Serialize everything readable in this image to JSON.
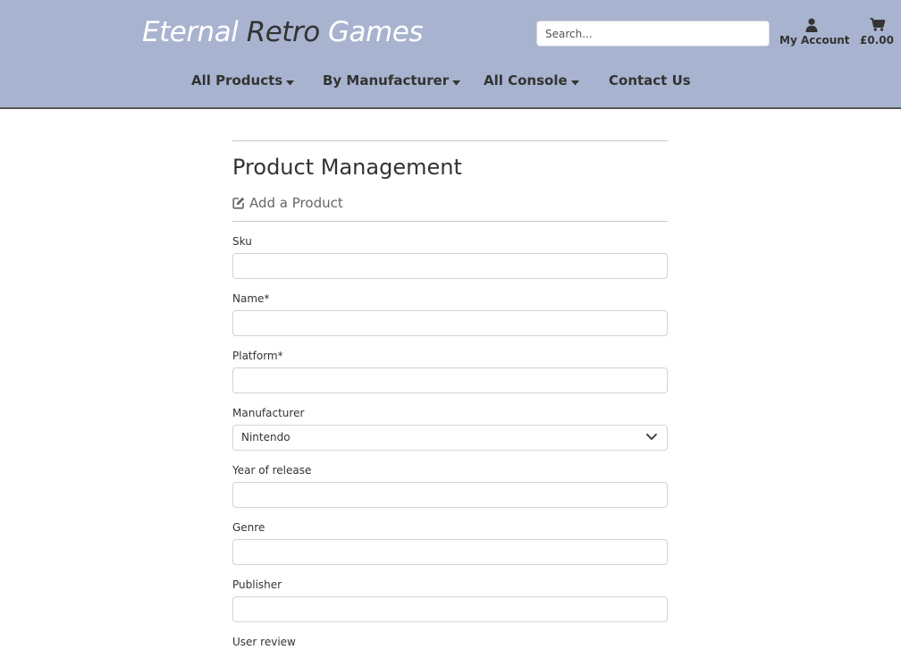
{
  "brand": {
    "word1": "Eternal",
    "word2": "Retro",
    "word3": "Games"
  },
  "search": {
    "placeholder": "Search..."
  },
  "account": {
    "label": "My Account",
    "icon": "user-icon"
  },
  "bag": {
    "total": "£0.00",
    "icon": "cart-icon"
  },
  "nav": {
    "items": [
      {
        "label": "All Products",
        "has_caret": true
      },
      {
        "label": "By Manufacturer",
        "has_caret": true
      },
      {
        "label": "All Console",
        "has_caret": true
      },
      {
        "label": "Contact Us",
        "has_caret": false
      }
    ]
  },
  "page": {
    "title": "Product Management",
    "subtitle": "Add a Product",
    "subtitle_icon": "edit-icon"
  },
  "form": {
    "fields": [
      {
        "label": "Sku",
        "value": ""
      },
      {
        "label": "Name*",
        "value": ""
      },
      {
        "label": "Platform*",
        "value": ""
      },
      {
        "label": "Manufacturer",
        "value": "Nintendo",
        "type": "select"
      },
      {
        "label": "Year of release",
        "value": ""
      },
      {
        "label": "Genre",
        "value": ""
      },
      {
        "label": "Publisher",
        "value": ""
      },
      {
        "label": "User review",
        "value": ""
      }
    ]
  },
  "colors": {
    "header_bg": "#a8b3cf",
    "text": "#333333",
    "muted": "#666666"
  }
}
